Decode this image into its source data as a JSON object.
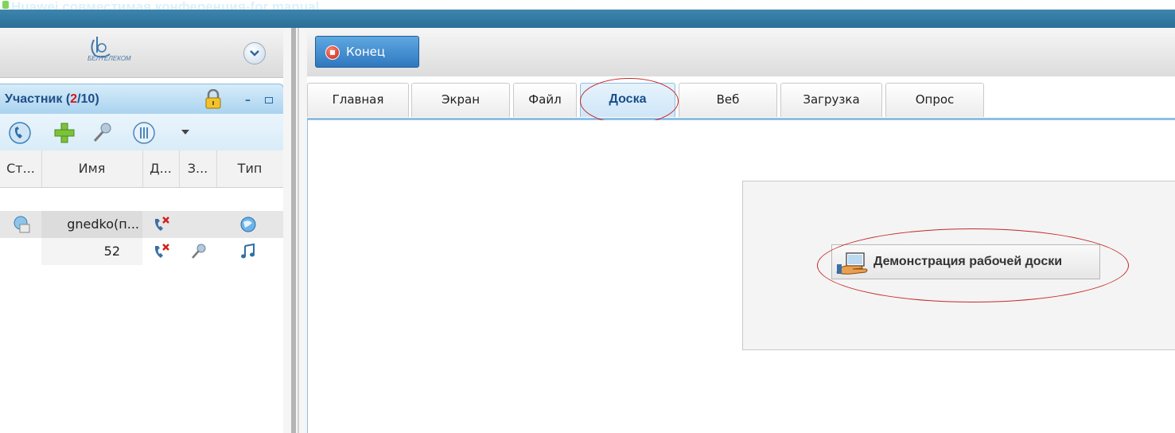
{
  "window": {
    "title": "Huawei совместимая конференция-for manual"
  },
  "logo": {
    "text": "БЕЛТЕЛЕКОМ"
  },
  "participants": {
    "title": "Участник",
    "count_open": "(",
    "count_current": "2",
    "count_total": "/10)",
    "columns": [
      "Ст...",
      "Имя",
      "Д...",
      "З...",
      "Тип"
    ],
    "rows": [
      {
        "name": "gnedko(п..."
      },
      {
        "name": "52"
      }
    ]
  },
  "toolbar": {
    "end_label": "Конец"
  },
  "tabs": [
    "Главная",
    "Экран",
    "Файл",
    "Доска",
    "Веб",
    "Загрузка",
    "Опрос"
  ],
  "active_tab": "Доска",
  "whiteboard": {
    "demo_button_label": "Демонстрация рабочей доски"
  },
  "colors": {
    "accent": "#2f78c0",
    "highlight_ellipse": "#c62828",
    "count_red": "#d01a1a"
  }
}
